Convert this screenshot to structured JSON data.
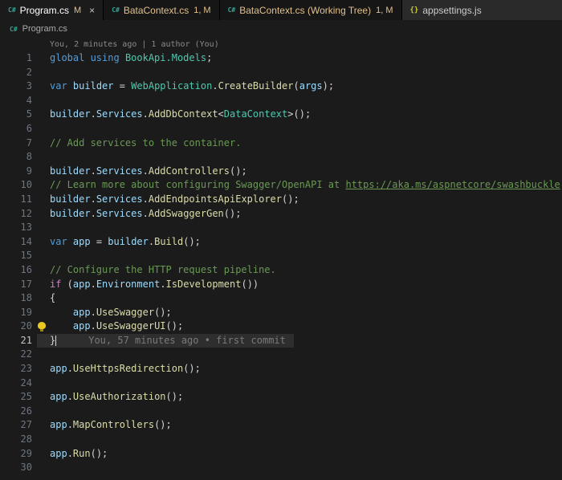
{
  "colors": {
    "editor_background": "#1b1b1b",
    "modified_badge": "#e2c08d",
    "csharp_icon": "#35a795",
    "json_icon": "#cbcb41",
    "comment_green": "#6a9955",
    "keyword_blue": "#569cd6",
    "type_teal": "#4ec9b0",
    "method_yellow": "#dcdcaa"
  },
  "icons": {
    "csharp": "C#",
    "json": "{}",
    "close": "×"
  },
  "tabs": [
    {
      "id": "program-cs",
      "icon": "csharp",
      "label": "Program.cs",
      "label_color": "#ffffff",
      "badge": "M",
      "badge_color": "#e2c08d",
      "active": true,
      "closable": true
    },
    {
      "id": "batacontext-cs",
      "icon": "csharp",
      "label": "BataContext.cs",
      "label_color": "#e2c08d",
      "badge": "1, M",
      "badge_color": "#e2c08d"
    },
    {
      "id": "batacontext-cs-working-tree",
      "icon": "csharp",
      "label": "BataContext.cs (Working Tree)",
      "label_color": "#e2c08d",
      "badge": "1, M",
      "badge_color": "#e2c08d"
    },
    {
      "id": "appsettings-js",
      "icon": "json",
      "label": "appsettings.js",
      "label_color": "#cccccc",
      "badge": "",
      "alt": true
    }
  ],
  "breadcrumb": {
    "label": "Program.cs"
  },
  "codelens": "You, 2 minutes ago | 1 author (You)",
  "editor": {
    "lines": [
      {
        "n": 1,
        "t": [
          [
            "kw",
            "global using"
          ],
          [
            "p",
            " "
          ],
          [
            "type",
            "BookApi.Models"
          ],
          [
            "p",
            ";"
          ]
        ]
      },
      {
        "n": 2,
        "t": []
      },
      {
        "n": 3,
        "t": [
          [
            "kw",
            "var"
          ],
          [
            "p",
            " "
          ],
          [
            "v",
            "builder"
          ],
          [
            "p",
            " = "
          ],
          [
            "type",
            "WebApplication"
          ],
          [
            "p",
            "."
          ],
          [
            "fn",
            "CreateBuilder"
          ],
          [
            "p",
            "("
          ],
          [
            "v",
            "args"
          ],
          [
            "p",
            ");"
          ]
        ]
      },
      {
        "n": 4,
        "t": []
      },
      {
        "n": 5,
        "t": [
          [
            "v",
            "builder"
          ],
          [
            "p",
            "."
          ],
          [
            "v",
            "Services"
          ],
          [
            "p",
            "."
          ],
          [
            "fn",
            "AddDbContext"
          ],
          [
            "p",
            "<"
          ],
          [
            "type",
            "DataContext"
          ],
          [
            "p",
            ">();"
          ]
        ]
      },
      {
        "n": 6,
        "t": []
      },
      {
        "n": 7,
        "t": [
          [
            "c",
            "// Add services to the container."
          ]
        ]
      },
      {
        "n": 8,
        "t": []
      },
      {
        "n": 9,
        "t": [
          [
            "v",
            "builder"
          ],
          [
            "p",
            "."
          ],
          [
            "v",
            "Services"
          ],
          [
            "p",
            "."
          ],
          [
            "fn",
            "AddControllers"
          ],
          [
            "p",
            "();"
          ]
        ]
      },
      {
        "n": 10,
        "t": [
          [
            "c",
            "// Learn more about configuring Swagger/OpenAPI at "
          ],
          [
            "link",
            "https://aka.ms/aspnetcore/swashbuckle"
          ]
        ]
      },
      {
        "n": 11,
        "t": [
          [
            "v",
            "builder"
          ],
          [
            "p",
            "."
          ],
          [
            "v",
            "Services"
          ],
          [
            "p",
            "."
          ],
          [
            "fn",
            "AddEndpointsApiExplorer"
          ],
          [
            "p",
            "();"
          ]
        ]
      },
      {
        "n": 12,
        "t": [
          [
            "v",
            "builder"
          ],
          [
            "p",
            "."
          ],
          [
            "v",
            "Services"
          ],
          [
            "p",
            "."
          ],
          [
            "fn",
            "AddSwaggerGen"
          ],
          [
            "p",
            "();"
          ]
        ]
      },
      {
        "n": 13,
        "t": []
      },
      {
        "n": 14,
        "t": [
          [
            "kw",
            "var"
          ],
          [
            "p",
            " "
          ],
          [
            "v",
            "app"
          ],
          [
            "p",
            " = "
          ],
          [
            "v",
            "builder"
          ],
          [
            "p",
            "."
          ],
          [
            "fn",
            "Build"
          ],
          [
            "p",
            "();"
          ]
        ]
      },
      {
        "n": 15,
        "t": []
      },
      {
        "n": 16,
        "t": [
          [
            "c",
            "// Configure the HTTP request pipeline."
          ]
        ]
      },
      {
        "n": 17,
        "t": [
          [
            "ctrl",
            "if"
          ],
          [
            "p",
            " ("
          ],
          [
            "v",
            "app"
          ],
          [
            "p",
            "."
          ],
          [
            "v",
            "Environment"
          ],
          [
            "p",
            "."
          ],
          [
            "fn",
            "IsDevelopment"
          ],
          [
            "p",
            "())"
          ]
        ]
      },
      {
        "n": 18,
        "t": [
          [
            "p",
            "{"
          ]
        ]
      },
      {
        "n": 19,
        "t": [
          [
            "p",
            "    "
          ],
          [
            "v",
            "app"
          ],
          [
            "p",
            "."
          ],
          [
            "fn",
            "UseSwagger"
          ],
          [
            "p",
            "();"
          ]
        ]
      },
      {
        "n": 20,
        "bulb": true,
        "t": [
          [
            "p",
            "    "
          ],
          [
            "v",
            "app"
          ],
          [
            "p",
            "."
          ],
          [
            "fn",
            "UseSwaggerUI"
          ],
          [
            "p",
            "();"
          ]
        ]
      },
      {
        "n": 21,
        "current": true,
        "cursor": true,
        "blame": "You, 57 minutes ago • first commit",
        "t": [
          [
            "p",
            "}"
          ]
        ]
      },
      {
        "n": 22,
        "t": []
      },
      {
        "n": 23,
        "t": [
          [
            "v",
            "app"
          ],
          [
            "p",
            "."
          ],
          [
            "fn",
            "UseHttpsRedirection"
          ],
          [
            "p",
            "();"
          ]
        ]
      },
      {
        "n": 24,
        "t": []
      },
      {
        "n": 25,
        "t": [
          [
            "v",
            "app"
          ],
          [
            "p",
            "."
          ],
          [
            "fn",
            "UseAuthorization"
          ],
          [
            "p",
            "();"
          ]
        ]
      },
      {
        "n": 26,
        "t": []
      },
      {
        "n": 27,
        "t": [
          [
            "v",
            "app"
          ],
          [
            "p",
            "."
          ],
          [
            "fn",
            "MapControllers"
          ],
          [
            "p",
            "();"
          ]
        ]
      },
      {
        "n": 28,
        "t": []
      },
      {
        "n": 29,
        "t": [
          [
            "v",
            "app"
          ],
          [
            "p",
            "."
          ],
          [
            "fn",
            "Run"
          ],
          [
            "p",
            "();"
          ]
        ]
      },
      {
        "n": 30,
        "t": []
      }
    ]
  }
}
